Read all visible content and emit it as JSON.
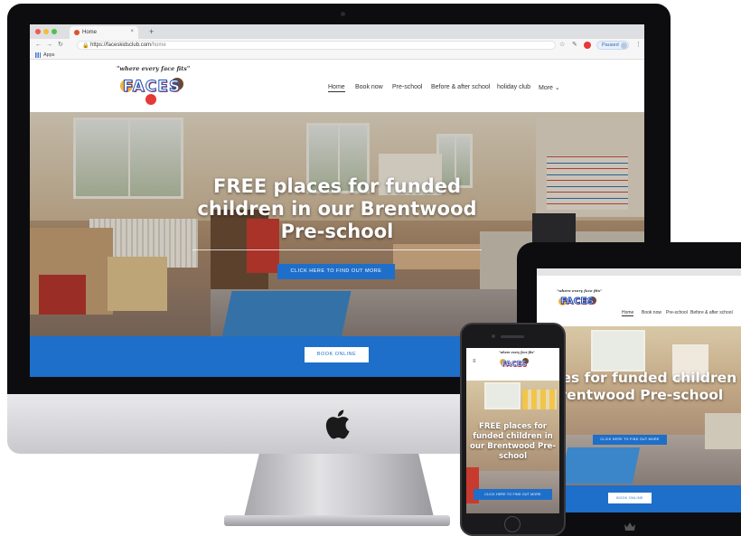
{
  "browser": {
    "tab_title": "Home",
    "tab_close": "×",
    "new_tab": "+",
    "back": "←",
    "forward": "→",
    "reload": "↻",
    "url_host": "https://faceskidsclub.com",
    "url_path": "/home",
    "star": "☆",
    "pin": "✎",
    "profile_status": "Paused",
    "menu_dots": "⋮",
    "bookmark_apps": "Apps"
  },
  "site": {
    "logo": {
      "tagline": "\"where every face fits\"",
      "word": "FACES"
    },
    "nav": [
      "Home",
      "Book now",
      "Pre-school",
      "Before & after school",
      "holiday club",
      "More"
    ],
    "more_caret": "⌄",
    "hero": {
      "title": "FREE places for funded children in our Brentwood Pre-school",
      "cta": "CLICK HERE TO FIND OUT MORE"
    },
    "book_online": "BOOK ONLINE"
  },
  "tablet": {
    "nav": [
      "Home",
      "Book now",
      "Pre-school",
      "Before & after school"
    ],
    "hero_title": "FREE places for funded children in our Brentwood Pre-school",
    "cta": "CLICK HERE TO FIND OUT MORE",
    "book_online": "BOOK ONLINE"
  },
  "phone": {
    "menu_icon": "≡",
    "hero_title": "FREE places for funded children in our Brentwood Pre-school",
    "cta": "CLICK HERE TO FIND OUT MORE"
  },
  "colors": {
    "brand_blue": "#1e6fc9",
    "device_black": "#0d0d0f"
  }
}
